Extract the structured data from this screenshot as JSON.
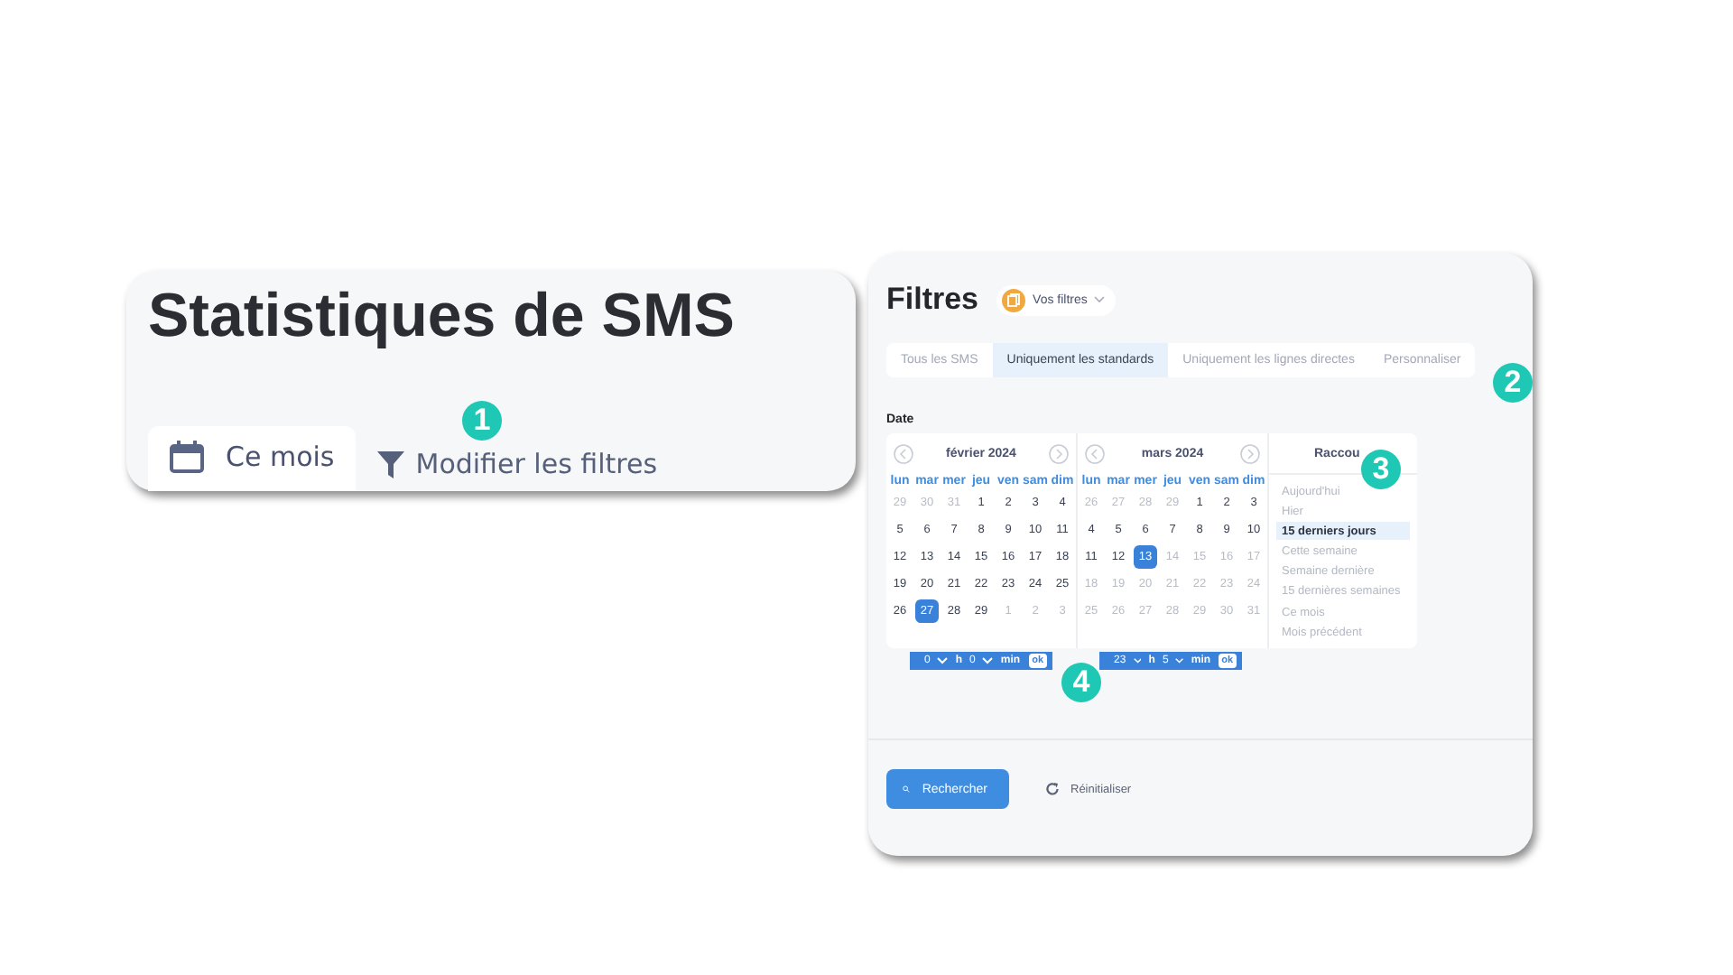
{
  "stats_card": {
    "title": "Statistiques de SMS",
    "period_button": "Ce mois",
    "filter_link": "Modifier les filtres"
  },
  "filters_panel": {
    "title": "Filtres",
    "saved_filters": "Vos filtres",
    "tabs": [
      {
        "label": "Tous les SMS",
        "selected": false
      },
      {
        "label": "Uniquement les standards",
        "selected": true
      },
      {
        "label": "Uniquement les lignes directes",
        "selected": false
      },
      {
        "label": "Personnaliser",
        "selected": false
      }
    ],
    "date_label": "Date",
    "months": [
      {
        "title": "février 2024",
        "weekdays": [
          "lun",
          "mar",
          "mer",
          "jeu",
          "ven",
          "sam",
          "dim"
        ],
        "weeks": [
          [
            {
              "day": "29",
              "muted": true,
              "selected": false
            },
            {
              "day": "30",
              "muted": true,
              "selected": false
            },
            {
              "day": "31",
              "muted": true,
              "selected": false
            },
            {
              "day": "1",
              "muted": false,
              "selected": false
            },
            {
              "day": "2",
              "muted": false,
              "selected": false
            },
            {
              "day": "3",
              "muted": false,
              "selected": false
            },
            {
              "day": "4",
              "muted": false,
              "selected": false
            }
          ],
          [
            {
              "day": "5",
              "muted": false,
              "selected": false
            },
            {
              "day": "6",
              "muted": false,
              "selected": false
            },
            {
              "day": "7",
              "muted": false,
              "selected": false
            },
            {
              "day": "8",
              "muted": false,
              "selected": false
            },
            {
              "day": "9",
              "muted": false,
              "selected": false
            },
            {
              "day": "10",
              "muted": false,
              "selected": false
            },
            {
              "day": "11",
              "muted": false,
              "selected": false
            }
          ],
          [
            {
              "day": "12",
              "muted": false,
              "selected": false
            },
            {
              "day": "13",
              "muted": false,
              "selected": false
            },
            {
              "day": "14",
              "muted": false,
              "selected": false
            },
            {
              "day": "15",
              "muted": false,
              "selected": false
            },
            {
              "day": "16",
              "muted": false,
              "selected": false
            },
            {
              "day": "17",
              "muted": false,
              "selected": false
            },
            {
              "day": "18",
              "muted": false,
              "selected": false
            }
          ],
          [
            {
              "day": "19",
              "muted": false,
              "selected": false
            },
            {
              "day": "20",
              "muted": false,
              "selected": false
            },
            {
              "day": "21",
              "muted": false,
              "selected": false
            },
            {
              "day": "22",
              "muted": false,
              "selected": false
            },
            {
              "day": "23",
              "muted": false,
              "selected": false
            },
            {
              "day": "24",
              "muted": false,
              "selected": false
            },
            {
              "day": "25",
              "muted": false,
              "selected": false
            }
          ],
          [
            {
              "day": "26",
              "muted": false,
              "selected": false
            },
            {
              "day": "27",
              "muted": false,
              "selected": true
            },
            {
              "day": "28",
              "muted": false,
              "selected": false
            },
            {
              "day": "29",
              "muted": false,
              "selected": false
            },
            {
              "day": "1",
              "muted": true,
              "selected": false
            },
            {
              "day": "2",
              "muted": true,
              "selected": false
            },
            {
              "day": "3",
              "muted": true,
              "selected": false
            }
          ]
        ],
        "time": {
          "hour": "0",
          "hour_unit": "h",
          "minute": "0",
          "minute_unit": "min",
          "ok": "ok"
        }
      },
      {
        "title": "mars 2024",
        "weekdays": [
          "lun",
          "mar",
          "mer",
          "jeu",
          "ven",
          "sam",
          "dim"
        ],
        "weeks": [
          [
            {
              "day": "26",
              "muted": true,
              "selected": false
            },
            {
              "day": "27",
              "muted": true,
              "selected": false
            },
            {
              "day": "28",
              "muted": true,
              "selected": false
            },
            {
              "day": "29",
              "muted": true,
              "selected": false
            },
            {
              "day": "1",
              "muted": false,
              "selected": false
            },
            {
              "day": "2",
              "muted": false,
              "selected": false
            },
            {
              "day": "3",
              "muted": false,
              "selected": false
            }
          ],
          [
            {
              "day": "4",
              "muted": false,
              "selected": false
            },
            {
              "day": "5",
              "muted": false,
              "selected": false
            },
            {
              "day": "6",
              "muted": false,
              "selected": false
            },
            {
              "day": "7",
              "muted": false,
              "selected": false
            },
            {
              "day": "8",
              "muted": false,
              "selected": false
            },
            {
              "day": "9",
              "muted": false,
              "selected": false
            },
            {
              "day": "10",
              "muted": false,
              "selected": false
            }
          ],
          [
            {
              "day": "11",
              "muted": false,
              "selected": false
            },
            {
              "day": "12",
              "muted": false,
              "selected": false
            },
            {
              "day": "13",
              "muted": false,
              "selected": true
            },
            {
              "day": "14",
              "muted": true,
              "selected": false
            },
            {
              "day": "15",
              "muted": true,
              "selected": false
            },
            {
              "day": "16",
              "muted": true,
              "selected": false
            },
            {
              "day": "17",
              "muted": true,
              "selected": false
            }
          ],
          [
            {
              "day": "18",
              "muted": true,
              "selected": false
            },
            {
              "day": "19",
              "muted": true,
              "selected": false
            },
            {
              "day": "20",
              "muted": true,
              "selected": false
            },
            {
              "day": "21",
              "muted": true,
              "selected": false
            },
            {
              "day": "22",
              "muted": true,
              "selected": false
            },
            {
              "day": "23",
              "muted": true,
              "selected": false
            },
            {
              "day": "24",
              "muted": true,
              "selected": false
            }
          ],
          [
            {
              "day": "25",
              "muted": true,
              "selected": false
            },
            {
              "day": "26",
              "muted": true,
              "selected": false
            },
            {
              "day": "27",
              "muted": true,
              "selected": false
            },
            {
              "day": "28",
              "muted": true,
              "selected": false
            },
            {
              "day": "29",
              "muted": true,
              "selected": false
            },
            {
              "day": "30",
              "muted": true,
              "selected": false
            },
            {
              "day": "31",
              "muted": true,
              "selected": false
            }
          ]
        ],
        "time": {
          "hour": "23",
          "hour_unit": "h",
          "minute": "5",
          "minute_unit": "min",
          "ok": "ok"
        }
      }
    ],
    "shortcuts": {
      "title": "Raccou",
      "items": [
        {
          "label": "Aujourd'hui",
          "selected": false
        },
        {
          "label": "Hier",
          "selected": false
        },
        {
          "label": "15 derniers jours",
          "selected": true
        },
        {
          "label": "Cette semaine",
          "selected": false
        },
        {
          "label": "Semaine dernière",
          "selected": false
        },
        {
          "label": "15 dernières semaines",
          "selected": false
        },
        {
          "label": "Ce mois",
          "selected": false
        },
        {
          "label": "Mois précédent",
          "selected": false
        }
      ]
    },
    "search_button": "Rechercher",
    "reset_button": "Réinitialiser"
  },
  "callouts": [
    {
      "label": "1"
    },
    {
      "label": "2"
    },
    {
      "label": "3"
    },
    {
      "label": "4"
    }
  ]
}
